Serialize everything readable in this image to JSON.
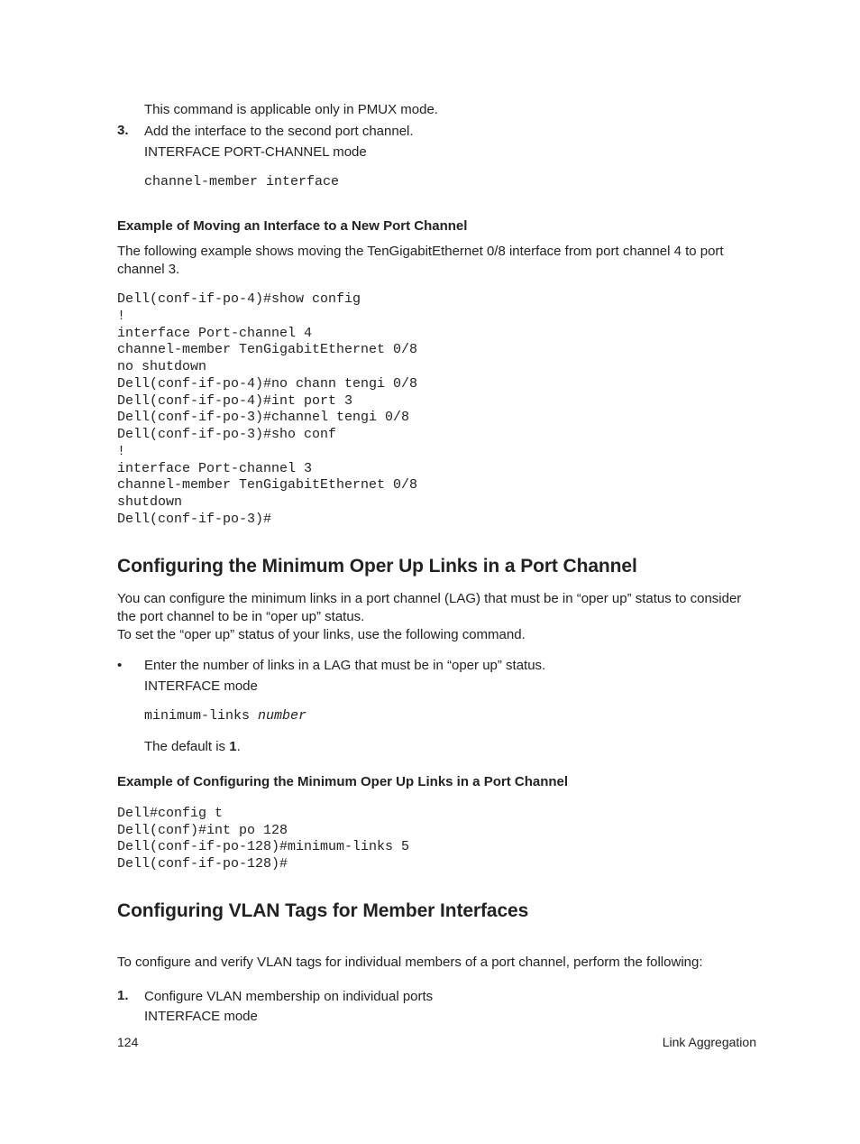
{
  "top": {
    "pmux_note": "This command is applicable only in PMUX mode.",
    "step3_num": "3.",
    "step3_text": "Add the interface to the second port channel.",
    "step3_mode": "INTERFACE PORT-CHANNEL mode",
    "step3_cmd": "channel-member interface"
  },
  "example1": {
    "heading": "Example of Moving an Interface to a New Port Channel",
    "intro": "The following example shows moving the TenGigabitEthernet 0/8 interface from port channel 4 to port channel 3.",
    "code": "Dell(conf-if-po-4)#show config\n!\ninterface Port-channel 4\nchannel-member TenGigabitEthernet 0/8\nno shutdown\nDell(conf-if-po-4)#no chann tengi 0/8\nDell(conf-if-po-4)#int port 3\nDell(conf-if-po-3)#channel tengi 0/8\nDell(conf-if-po-3)#sho conf\n!\ninterface Port-channel 3\nchannel-member TenGigabitEthernet 0/8\nshutdown\nDell(conf-if-po-3)#"
  },
  "section2": {
    "heading": "Configuring the Minimum Oper Up Links in a Port Channel",
    "para1": "You can configure the minimum links in a port channel (LAG) that must be in “oper up” status to consider the port channel to be in “oper up” status.",
    "para2": "To set the “oper up” status of your links, use the following command.",
    "bullet_text": "Enter the number of links in a LAG that must be in “oper up” status.",
    "bullet_mode": "INTERFACE mode",
    "cmd_prefix": "minimum-links ",
    "cmd_arg": "number",
    "default_prefix": "The default is ",
    "default_value": "1",
    "default_suffix": "."
  },
  "example2": {
    "heading": "Example of Configuring the Minimum Oper Up Links in a Port Channel",
    "code": "Dell#config t\nDell(conf)#int po 128\nDell(conf-if-po-128)#minimum-links 5\nDell(conf-if-po-128)#"
  },
  "section3": {
    "heading": "Configuring VLAN Tags for Member Interfaces",
    "intro": "To configure and verify VLAN tags for individual members of a port channel, perform the following:",
    "step1_num": "1.",
    "step1_text": "Configure VLAN membership on individual ports",
    "step1_mode": "INTERFACE mode"
  },
  "footer": {
    "page": "124",
    "title": "Link Aggregation"
  }
}
